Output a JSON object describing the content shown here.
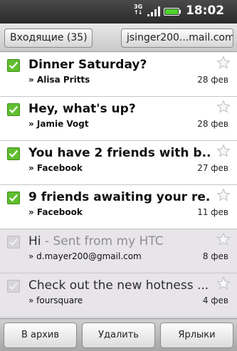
{
  "status_bar": {
    "network": "3G",
    "network_arrows": "↑↓",
    "time": "18:02",
    "icons": [
      "signal-icon",
      "battery-icon"
    ]
  },
  "header": {
    "folder_button": "Входящие (35)",
    "account_button": "jsinger200...mail.com"
  },
  "messages": [
    {
      "subject": "Dinner Saturday?",
      "snippet": "",
      "sender": "» Alisa Pritts",
      "date": "28 фев",
      "read": false,
      "checked": true,
      "starred": false
    },
    {
      "subject": "Hey, what's up?",
      "snippet": "",
      "sender": "» Jamie Vogt",
      "date": "28 фев",
      "read": false,
      "checked": true,
      "starred": false
    },
    {
      "subject": "You have 2 friends with b...",
      "snippet": "",
      "sender": "» Facebook",
      "date": "27 фев",
      "read": false,
      "checked": true,
      "starred": false
    },
    {
      "subject": "9 friends awaiting your re...",
      "snippet": "",
      "sender": "» Facebook",
      "date": "11 фев",
      "read": false,
      "checked": true,
      "starred": false
    },
    {
      "subject": "Hi",
      "snippet": " - Sent from my HTC",
      "sender": "» d.mayer200@gmail.com",
      "date": "8 фев",
      "read": true,
      "checked": false,
      "starred": false
    },
    {
      "subject": "Check out the new hotness ...",
      "snippet": "",
      "sender": "» foursquare",
      "date": "4 фев",
      "read": true,
      "checked": false,
      "starred": false
    }
  ],
  "toolbar": {
    "archive_label": "В архив",
    "delete_label": "Удалить",
    "labels_label": "Ярлыки"
  },
  "colors": {
    "checkbox_on": "#5fbe2e",
    "read_row_bg": "#e7e4ea",
    "status_bar_bg": "#2a2a2a"
  }
}
